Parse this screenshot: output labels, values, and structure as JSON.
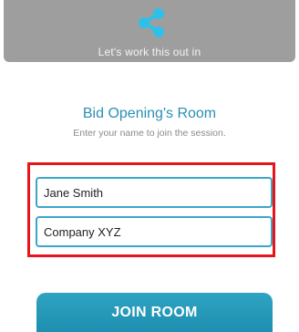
{
  "banner": {
    "icon": "share-icon",
    "tagline": "Let's work this out in"
  },
  "room": {
    "title": "Bid Opening's Room",
    "subtitle": "Enter your name to join the session."
  },
  "form": {
    "name_value": "Jane Smith",
    "company_value": "Company XYZ"
  },
  "join_button": {
    "label": "JOIN ROOM"
  },
  "colors": {
    "accent": "#2a8fb3",
    "button": "#2fa3c2",
    "highlight": "#e8141c",
    "banner": "#9e9e9e"
  }
}
